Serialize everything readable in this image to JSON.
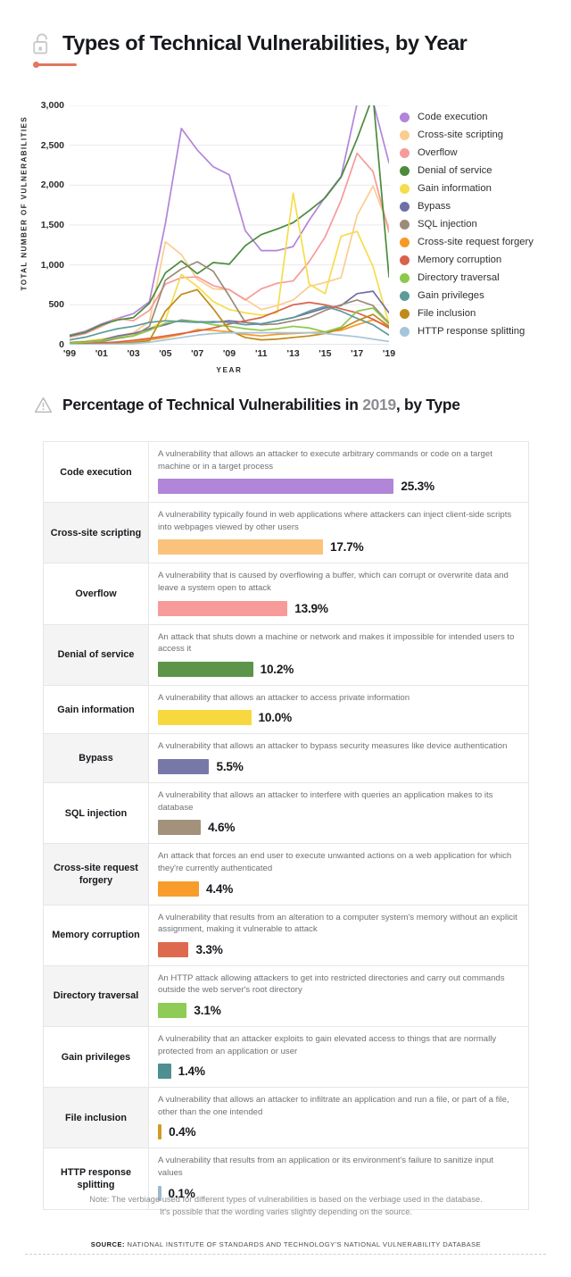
{
  "header1": {
    "title": "Types of Technical Vulnerabilities, by Year",
    "icon": "open-padlock-icon",
    "accent_color": "#e0785c"
  },
  "header2": {
    "title_before": "Percentage of Technical Vulnerabilities in ",
    "year": "2019",
    "title_after": ", by Type",
    "icon": "warning-triangle-icon"
  },
  "chart_data": {
    "type": "line",
    "title": "Types of Technical Vulnerabilities, by Year",
    "xlabel": "YEAR",
    "ylabel": "TOTAL NUMBER OF VULNERABILITIES",
    "ylim": [
      0,
      3000
    ],
    "yticks": [
      "0",
      "500",
      "1,000",
      "1,500",
      "2,000",
      "2,500",
      "3,000"
    ],
    "ytick_values": [
      0,
      500,
      1000,
      1500,
      2000,
      2500,
      3000
    ],
    "xticks": [
      "'99",
      "'01",
      "'03",
      "'05",
      "'07",
      "'09",
      "'11",
      "'13",
      "'15",
      "'17",
      "'19"
    ],
    "x": [
      1999,
      2000,
      2001,
      2002,
      2003,
      2004,
      2005,
      2006,
      2007,
      2008,
      2009,
      2010,
      2011,
      2012,
      2013,
      2014,
      2015,
      2016,
      2017,
      2018,
      2019
    ],
    "xlim": [
      1999,
      2019
    ],
    "grid": "horizontal",
    "legend_position": "right",
    "series": [
      {
        "name": "Code execution",
        "color": "#b185d8",
        "values": [
          120,
          170,
          260,
          330,
          390,
          540,
          1520,
          2710,
          2440,
          2230,
          2130,
          1430,
          1180,
          1180,
          1230,
          1560,
          1850,
          2110,
          3020,
          3050,
          2280
        ]
      },
      {
        "name": "Cross-site scripting",
        "color": "#fbcc8f",
        "values": [
          15,
          25,
          60,
          110,
          150,
          290,
          1290,
          1130,
          820,
          700,
          690,
          570,
          440,
          490,
          560,
          730,
          780,
          840,
          1620,
          1990,
          1470
        ]
      },
      {
        "name": "Overflow",
        "color": "#f79a9a",
        "values": [
          95,
          140,
          230,
          330,
          300,
          430,
          760,
          840,
          850,
          740,
          690,
          560,
          700,
          770,
          800,
          1040,
          1350,
          1810,
          2400,
          2170,
          1410
        ]
      },
      {
        "name": "Denial of service",
        "color": "#4b8b3b",
        "values": [
          110,
          155,
          250,
          310,
          340,
          520,
          900,
          1050,
          890,
          1030,
          1010,
          1240,
          1380,
          1450,
          1530,
          1680,
          1840,
          2100,
          2580,
          3120,
          850
        ]
      },
      {
        "name": "Gain information",
        "color": "#f5dd4b",
        "values": [
          30,
          45,
          70,
          100,
          130,
          200,
          310,
          880,
          730,
          540,
          440,
          400,
          370,
          400,
          1900,
          760,
          640,
          1360,
          1420,
          980,
          260
        ]
      },
      {
        "name": "Bypass",
        "color": "#6f6fa8",
        "values": [
          25,
          35,
          55,
          110,
          140,
          200,
          250,
          310,
          290,
          280,
          300,
          280,
          260,
          300,
          340,
          400,
          460,
          490,
          640,
          670,
          400
        ]
      },
      {
        "name": "SQL injection",
        "color": "#9b8b77",
        "values": [
          10,
          20,
          35,
          80,
          110,
          230,
          810,
          950,
          1040,
          920,
          610,
          280,
          250,
          260,
          300,
          340,
          430,
          500,
          560,
          490,
          270
        ]
      },
      {
        "name": "Cross-site request forgery",
        "color": "#f89828",
        "values": [
          5,
          8,
          14,
          25,
          40,
          60,
          90,
          130,
          190,
          180,
          160,
          130,
          110,
          130,
          140,
          150,
          160,
          180,
          250,
          310,
          230
        ]
      },
      {
        "name": "Memory corruption",
        "color": "#d9624a",
        "values": [
          8,
          12,
          20,
          35,
          55,
          80,
          110,
          140,
          170,
          210,
          260,
          300,
          340,
          420,
          500,
          530,
          500,
          450,
          400,
          320,
          210
        ]
      },
      {
        "name": "Directory traversal",
        "color": "#8cc84b",
        "values": [
          20,
          30,
          50,
          90,
          110,
          180,
          270,
          300,
          290,
          250,
          230,
          200,
          180,
          200,
          230,
          210,
          160,
          220,
          420,
          460,
          260
        ]
      },
      {
        "name": "Gain privileges",
        "color": "#5e9a9a",
        "values": [
          60,
          95,
          150,
          200,
          230,
          280,
          300,
          290,
          280,
          290,
          280,
          250,
          260,
          300,
          340,
          420,
          480,
          420,
          330,
          250,
          120
        ]
      },
      {
        "name": "File inclusion",
        "color": "#c08a18",
        "values": [
          2,
          4,
          8,
          15,
          25,
          50,
          420,
          630,
          690,
          450,
          180,
          90,
          60,
          70,
          90,
          110,
          140,
          200,
          300,
          380,
          230
        ]
      },
      {
        "name": "HTTP response splitting",
        "color": "#a6c5d9",
        "values": [
          1,
          2,
          4,
          8,
          15,
          30,
          60,
          90,
          120,
          140,
          150,
          150,
          150,
          150,
          150,
          150,
          140,
          120,
          100,
          70,
          40
        ]
      }
    ]
  },
  "table": {
    "rows": [
      {
        "name": "Code execution",
        "desc": "A vulnerability that allows an attacker to execute arbitrary commands or code on a target machine or in a target process",
        "pct": "25.3%",
        "value": 25.3,
        "color": "#b185d8"
      },
      {
        "name": "Cross-site scripting",
        "desc": "A vulnerability typically found in web applications where attackers can inject client-side scripts into webpages viewed by other users",
        "pct": "17.7%",
        "value": 17.7,
        "color": "#fbc27c"
      },
      {
        "name": "Overflow",
        "desc": "A vulnerability that is caused by overflowing a buffer, which can corrupt or overwrite data and leave a system open to attack",
        "pct": "13.9%",
        "value": 13.9,
        "color": "#f79a9a"
      },
      {
        "name": "Denial of service",
        "desc": "An attack that shuts down a machine or network and makes it impossible for intended users to access it",
        "pct": "10.2%",
        "value": 10.2,
        "color": "#5c9449"
      },
      {
        "name": "Gain information",
        "desc": "A vulnerability that allows an attacker to access private information",
        "pct": "10.0%",
        "value": 10.0,
        "color": "#f7d93f"
      },
      {
        "name": "Bypass",
        "desc": "A vulnerability that allows an attacker to bypass security measures like device authentication",
        "pct": "5.5%",
        "value": 5.5,
        "color": "#7878a8"
      },
      {
        "name": "SQL injection",
        "desc": "A vulnerability that allows an attacker to interfere with queries an application makes to its database",
        "pct": "4.6%",
        "value": 4.6,
        "color": "#a2927c"
      },
      {
        "name": "Cross-site request forgery",
        "desc": "An attack that forces an end user to execute unwanted actions on a web application for which they're currently authenticated",
        "pct": "4.4%",
        "value": 4.4,
        "color": "#f89c2c"
      },
      {
        "name": "Memory corruption",
        "desc": "A vulnerability that results from an alteration to a computer system's memory without an explicit assignment, making it vulnerable to attack",
        "pct": "3.3%",
        "value": 3.3,
        "color": "#dd6a4e"
      },
      {
        "name": "Directory traversal",
        "desc": "An HTTP attack allowing attackers to get into restricted directories and carry out commands outside the web server's root directory",
        "pct": "3.1%",
        "value": 3.1,
        "color": "#8ecc55"
      },
      {
        "name": "Gain privileges",
        "desc": "A vulnerability that an attacker exploits to gain elevated access to things that are normally protected from an application or user",
        "pct": "1.4%",
        "value": 1.4,
        "color": "#4f8f91"
      },
      {
        "name": "File inclusion",
        "desc": "A vulnerability that allows an attacker to infiltrate an application and run a file, or part of a file, other than the one intended",
        "pct": "0.4%",
        "value": 0.4,
        "color": "#d19b24"
      },
      {
        "name": "HTTP response splitting",
        "desc": "A vulnerability that results from an application or its environment's failure to sanitize input values",
        "pct": "0.1%",
        "value": 0.1,
        "color": "#9fb9cc"
      }
    ]
  },
  "footer": {
    "note_line1": "Note: The verbiage used for different types of vulnerabilities is based on the verbiage used in the database.",
    "note_line2": "It's possible that the wording varies slightly depending on the source.",
    "source_label": "SOURCE:",
    "source_text": "NATIONAL INSTITUTE OF STANDARDS AND TECHNOLOGY'S NATIONAL VULNERABILITY DATABASE"
  }
}
